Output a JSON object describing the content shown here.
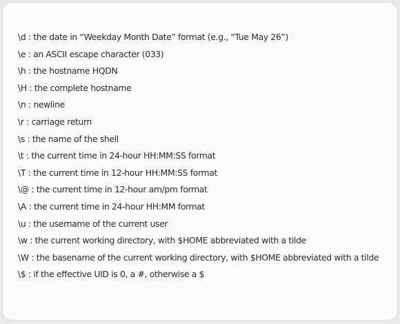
{
  "items": [
    "\\d : the date in “Weekday Month Date” format (e.g., “Tue May 26”)",
    "\\e : an ASCII escape character (033)",
    "\\h : the hostname HQDN",
    "\\H : the complete hostname",
    "\\n : newline",
    "\\r : carriage return",
    "\\s : the name of the shell",
    "\\t : the current time in 24-hour HH:MM:SS format",
    "\\T : the current time in 12-hour HH:MM:SS format",
    "\\@ : the current time in 12-hour am/pm format",
    "\\A : the current time in 24-hour HH:MM format",
    "\\u : the username of the current user",
    "\\w : the current working directory, with $HOME abbreviated with a tilde",
    "\\W : the basename of the current working directory, with $HOME abbreviated with a tilde",
    "\\$ : if the effective UID is 0, a #, otherwise a $"
  ]
}
